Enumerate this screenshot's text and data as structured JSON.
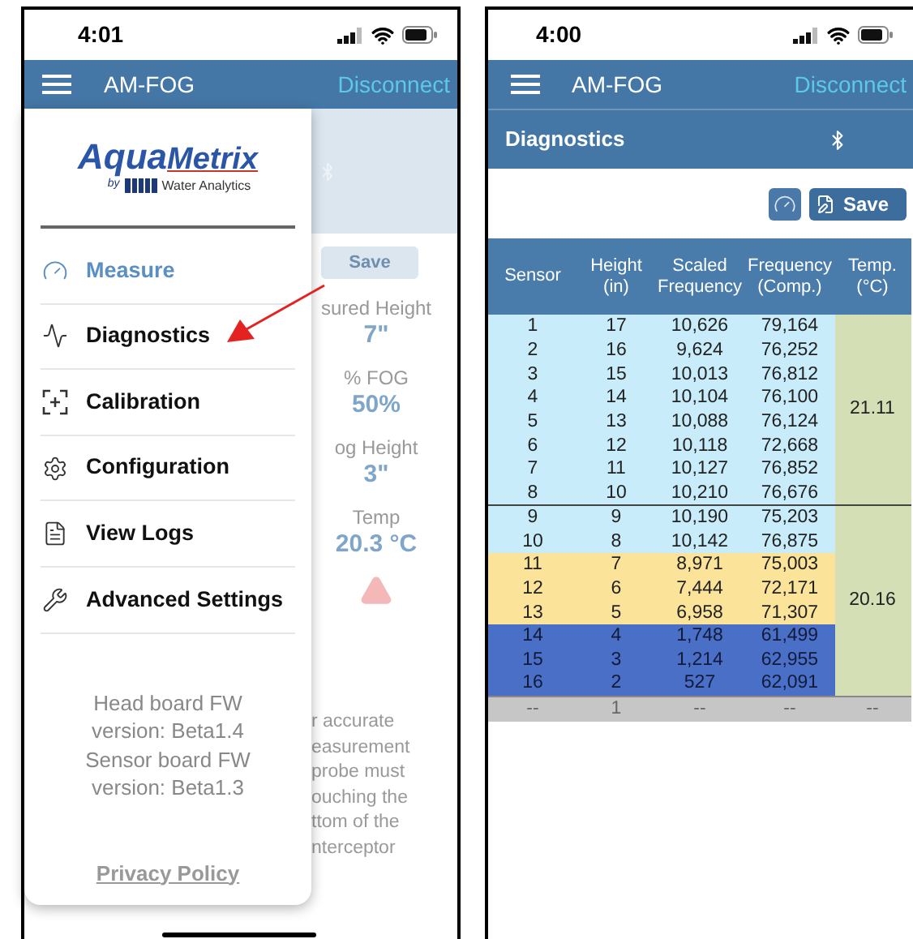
{
  "left_phone": {
    "status_bar": {
      "time": "4:01"
    },
    "header": {
      "title": "AM-FOG",
      "action": "Disconnect"
    },
    "drawer": {
      "logo": {
        "word_1": "Aqua",
        "word_2": "Metrix",
        "by": "by",
        "tagline": "Water Analytics"
      },
      "items": [
        {
          "label": "Measure",
          "selected": true
        },
        {
          "label": "Diagnostics",
          "selected": false
        },
        {
          "label": "Calibration",
          "selected": false
        },
        {
          "label": "Configuration",
          "selected": false
        },
        {
          "label": "View Logs",
          "selected": false
        },
        {
          "label": "Advanced Settings",
          "selected": false
        }
      ],
      "firmware": [
        "Head board FW",
        "version: Beta1.4",
        "Sensor board FW",
        "version: Beta1.3"
      ],
      "privacy_link": "Privacy Policy"
    },
    "background": {
      "save_button": "Save",
      "readings": [
        {
          "label": "sured Height",
          "value": "7\""
        },
        {
          "label": "% FOG",
          "value": "50%"
        },
        {
          "label": "og Height",
          "value": "3\""
        },
        {
          "label": "Temp",
          "value": "20.3 °C"
        }
      ],
      "note": [
        "r accurate",
        "easurement",
        "probe must",
        "ouching the",
        "ttom of the",
        "nterceptor"
      ]
    }
  },
  "right_phone": {
    "status_bar": {
      "time": "4:00"
    },
    "header": {
      "title": "AM-FOG",
      "action": "Disconnect"
    },
    "subheader": {
      "title": "Diagnostics"
    },
    "save_button": "Save",
    "table": {
      "columns": [
        "Sensor",
        "Height (in)",
        "Scaled Frequency",
        "Frequency (Comp.)",
        "Temp. (°C)"
      ],
      "groups": [
        {
          "temp": "21.11",
          "rows": [
            {
              "cells": [
                "1",
                "17",
                "10,626",
                "79,164"
              ],
              "color": "#c9ecfb"
            },
            {
              "cells": [
                "2",
                "16",
                "9,624",
                "76,252"
              ],
              "color": "#c9ecfb"
            },
            {
              "cells": [
                "3",
                "15",
                "10,013",
                "76,812"
              ],
              "color": "#c9ecfb"
            },
            {
              "cells": [
                "4",
                "14",
                "10,104",
                "76,100"
              ],
              "color": "#c9ecfb"
            },
            {
              "cells": [
                "5",
                "13",
                "10,088",
                "76,124"
              ],
              "color": "#c9ecfb"
            },
            {
              "cells": [
                "6",
                "12",
                "10,118",
                "72,668"
              ],
              "color": "#c9ecfb"
            },
            {
              "cells": [
                "7",
                "11",
                "10,127",
                "76,852"
              ],
              "color": "#c9ecfb"
            },
            {
              "cells": [
                "8",
                "10",
                "10,210",
                "76,676"
              ],
              "color": "#c9ecfb"
            }
          ]
        },
        {
          "temp": "20.16",
          "rows": [
            {
              "cells": [
                "9",
                "9",
                "10,190",
                "75,203"
              ],
              "color": "#c9ecfb"
            },
            {
              "cells": [
                "10",
                "8",
                "10,142",
                "76,875"
              ],
              "color": "#c9ecfb"
            },
            {
              "cells": [
                "11",
                "7",
                "8,971",
                "75,003"
              ],
              "color": "#fbe39a"
            },
            {
              "cells": [
                "12",
                "6",
                "7,444",
                "72,171"
              ],
              "color": "#fbe39a"
            },
            {
              "cells": [
                "13",
                "5",
                "6,958",
                "71,307"
              ],
              "color": "#fbe39a"
            },
            {
              "cells": [
                "14",
                "4",
                "1,748",
                "61,499"
              ],
              "color": "#4a6fc6"
            },
            {
              "cells": [
                "15",
                "3",
                "1,214",
                "62,955"
              ],
              "color": "#4a6fc6"
            },
            {
              "cells": [
                "16",
                "2",
                "527",
                "62,091"
              ],
              "color": "#4a6fc6"
            }
          ]
        }
      ],
      "footer_row": [
        "--",
        "1",
        "--",
        "--",
        "--"
      ]
    }
  }
}
